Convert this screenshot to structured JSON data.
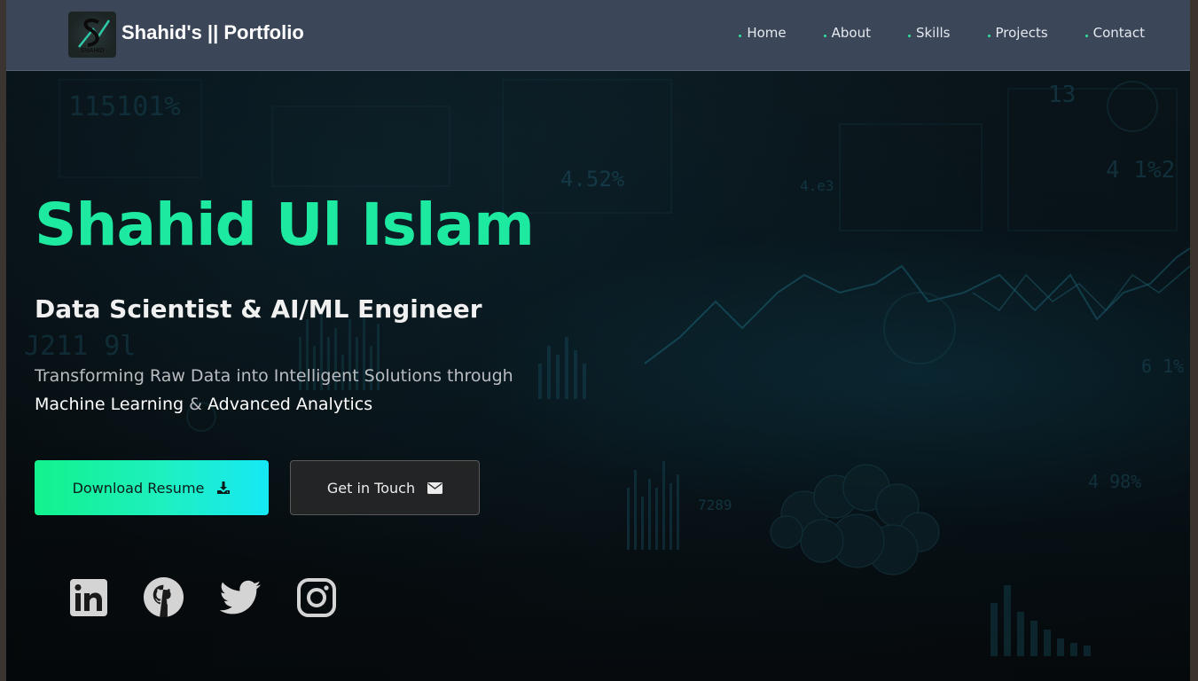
{
  "brand": {
    "title": "Shahid's || Portfolio",
    "logo_text": "SHAHID"
  },
  "nav": {
    "items": [
      {
        "label": "Home"
      },
      {
        "label": "About"
      },
      {
        "label": "Skills"
      },
      {
        "label": "Projects"
      },
      {
        "label": "Contact"
      }
    ]
  },
  "hero": {
    "name": "Shahid Ul Islam",
    "role": "Data Scientist & AI/ML Engineer",
    "tagline_line1": "Transforming Raw Data into Intelligent Solutions through",
    "tagline_hl1": "Machine Learning",
    "tagline_amp": " & ",
    "tagline_hl2": "Advanced Analytics",
    "download_label": "Download Resume",
    "download_icon": "download-icon",
    "contact_label": "Get in Touch",
    "contact_icon": "envelope-icon"
  },
  "socials": [
    {
      "name": "linkedin-icon"
    },
    {
      "name": "github-icon"
    },
    {
      "name": "twitter-icon"
    },
    {
      "name": "instagram-icon"
    }
  ],
  "colors": {
    "accent": "#1ee9a0",
    "navbar": "#3b4658",
    "button_gradient_start": "#11f28c",
    "button_gradient_end": "#16e8f5",
    "social_icons": "#d4d4d4"
  }
}
